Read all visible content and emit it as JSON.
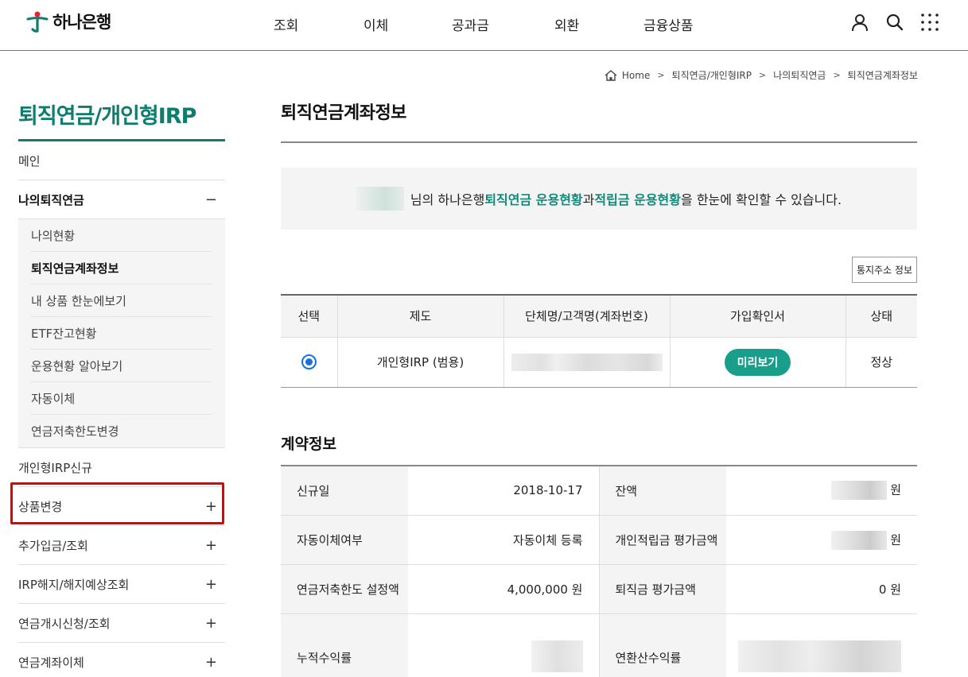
{
  "header": {
    "brand": "하나은행",
    "nav": [
      "조회",
      "이체",
      "공과금",
      "외환",
      "금융상품"
    ],
    "icons": [
      "user-icon",
      "search-icon",
      "menu-grid-icon"
    ],
    "brand_color": "#0f7c6d",
    "accent_red": "#e60000"
  },
  "breadcrumb": [
    "Home",
    "퇴직연금/개인형IRP",
    "나의퇴직연금",
    "퇴직연금계좌정보"
  ],
  "lnb": {
    "title": "퇴직연금/개인형IRP",
    "items": [
      {
        "label": "메인",
        "toggle": ""
      },
      {
        "label": "나의퇴직연금",
        "toggle": "−"
      },
      {
        "label": "개인형IRP신규",
        "toggle": ""
      },
      {
        "label": "상품변경",
        "toggle": "+"
      },
      {
        "label": "추가입금/조회",
        "toggle": "+"
      },
      {
        "label": "IRP해지/해지예상조회",
        "toggle": "+"
      },
      {
        "label": "연금개시신청/조회",
        "toggle": "+"
      },
      {
        "label": "연금계좌이체",
        "toggle": "+"
      }
    ],
    "sub": [
      "나의현황",
      "퇴직연금계좌정보",
      "내 상품 한눈에보기",
      "ETF잔고현황",
      "운용현황 알아보기",
      "자동이체",
      "연금저축한도변경"
    ]
  },
  "main": {
    "title": "퇴직연금계좌정보",
    "notice": {
      "pre": "님의 하나은행 ",
      "hl1": "퇴직연금 운용현황",
      "mid": "과 ",
      "hl2": "적립금 운용현황",
      "post": "을 한눈에 확인할 수 있습니다."
    },
    "addr_button": "통지주소 정보",
    "table": {
      "headers": [
        "선택",
        "제도",
        "단체명/고객명(계좌번호)",
        "가입확인서",
        "상태"
      ],
      "row": {
        "plan": "개인형IRP (범용)",
        "preview": "미리보기",
        "status": "정상"
      }
    },
    "contract": {
      "title": "계약정보",
      "rows": [
        {
          "l1": "신규일",
          "v1": "2018-10-17",
          "l2": "잔액",
          "v2_unit": "원"
        },
        {
          "l1": "자동이체여부",
          "v1": "자동이체 등록",
          "l2": "개인적립금 평가금액",
          "v2_unit": "원"
        },
        {
          "l1": "연금저축한도 설정액",
          "v1": "4,000,000 원",
          "l2": "퇴직금 평가금액",
          "v2": "0 원"
        },
        {
          "l1": "누적수익률",
          "l2": "연환산수익률"
        }
      ]
    }
  }
}
